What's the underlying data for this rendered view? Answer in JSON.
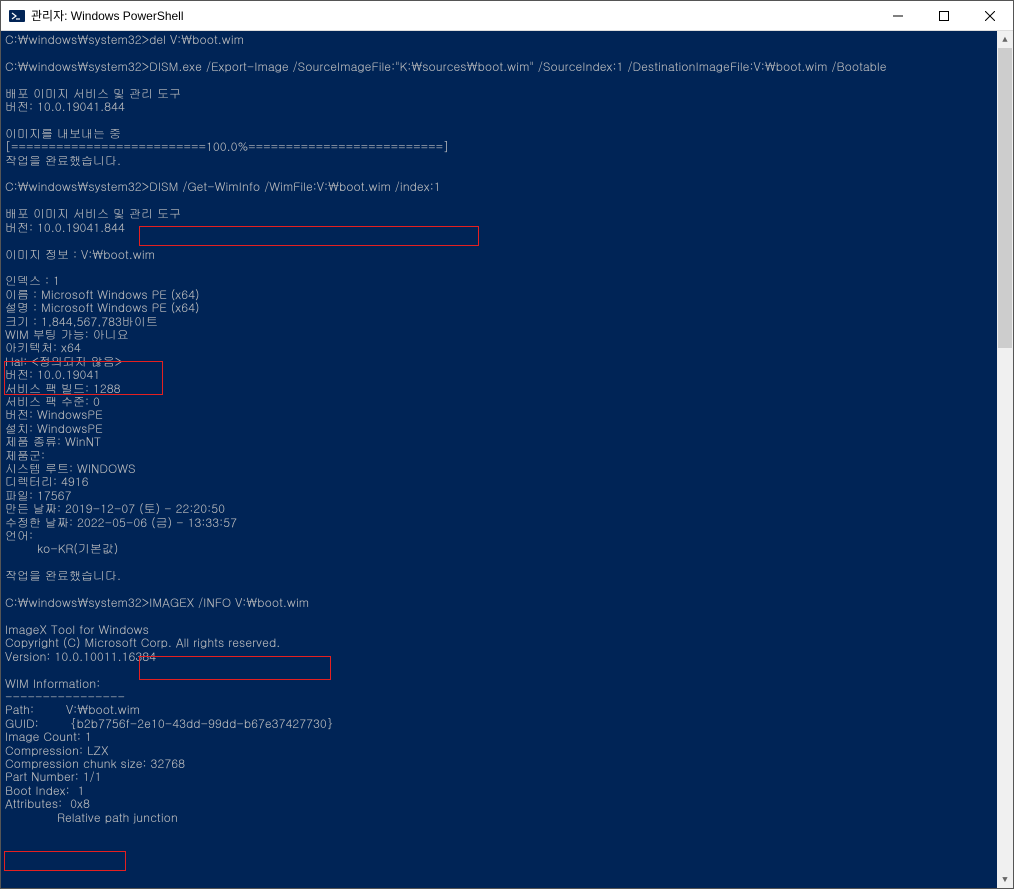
{
  "window": {
    "title": "관리자: Windows PowerShell",
    "min_label": "Minimize",
    "max_label": "Maximize",
    "close_label": "Close"
  },
  "prompt": "C:\\windows\\system32>",
  "cmd1": "del V:\\boot.wim",
  "cmd2": "DISM.exe /Export-Image /SourceImageFile:\"K:\\sources\\boot.wim\" /SourceIndex:1 /DestinationImageFile:V:\\boot.wim /Bootable",
  "cmd3": "DISM /Get-WimInfo /WimFile:V:\\boot.wim /index:1",
  "cmd4": "IMAGEX /INFO V:\\boot.wim",
  "dism": {
    "tool_title": "배포 이미지 서비스 및 관리 도구",
    "version_line": "버전: 10.0.19041.844",
    "exporting": "이미지를 내보내는 중",
    "progress": "[==========================100.0%==========================]",
    "done": "작업을 완료했습니다.",
    "info_header": "이미지 정보 : V:\\boot.wim",
    "index": "인덱스 : 1",
    "name": "이름 : Microsoft Windows PE (x64)",
    "desc": "설명 : Microsoft Windows PE (x64)",
    "size": "크기 : 1,844,567,783바이트",
    "wimboot": "WIM 부팅 가능: 아니요",
    "arch": "아키텍처: x64",
    "hal": "Hal: <정의되지 않음>",
    "ver": "버전: 10.0.19041",
    "spb": "서비스 팩 빌드: 1288",
    "sps": "서비스 팩 수준: 0",
    "edition": "버전: WindowsPE",
    "install": "설치: WindowsPE",
    "prodtype": "제품 종류: WinNT",
    "prodgrp": "제품군:",
    "sysroot": "시스템 루트: WINDOWS",
    "dirs": "디렉터리: 4916",
    "files": "파일: 17567",
    "created": "만든 날짜: 2019-12-07 (토) - 22:20:50",
    "modified": "수정한 날짜: 2022-05-06 (금) - 13:33:57",
    "lang_label": "언어:",
    "lang_val": "        ko-KR(기본값)"
  },
  "imagex": {
    "title": "ImageX Tool for Windows",
    "copy": "Copyright (C) Microsoft Corp. All rights reserved.",
    "ver": "Version: 10.0.10011.16384",
    "hdr": "WIM Information:",
    "rule": "----------------",
    "path": "Path:        V:\\boot.wim",
    "guid": "GUID:        {b2b7756f-2e10-43dd-99dd-b67e37427730}",
    "count": "Image Count: 1",
    "comp": "Compression: LZX",
    "chunk": "Compression chunk size: 32768",
    "part": "Part Number: 1/1",
    "bootidx": "Boot Index:  1",
    "attr": "Attributes:  0x8",
    "attr2": "             Relative path junction"
  },
  "scroll": {
    "up": "▲",
    "down": "▼"
  }
}
